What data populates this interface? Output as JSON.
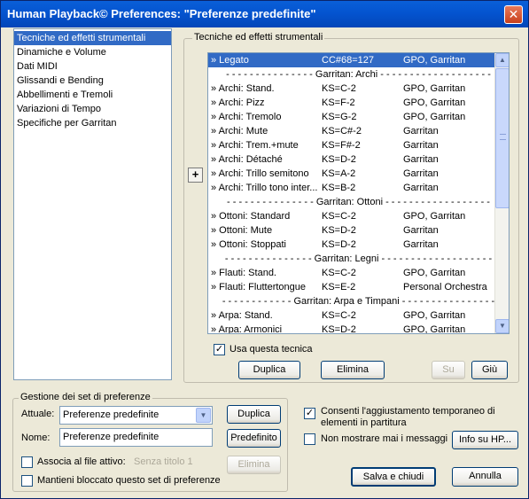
{
  "window": {
    "title": "Human Playback© Preferences: \"Preferenze predefinite\"",
    "close_label": "✕"
  },
  "categories": [
    "Tecniche ed effetti strumentali",
    "Dinamiche e Volume",
    "Dati MIDI",
    "Glissandi e Bending",
    "Abbellimenti e Tremoli",
    "Variazioni di Tempo",
    "Specifiche per Garritan"
  ],
  "techniques": {
    "group_title": "Tecniche ed effetti strumentali",
    "add_label": "+",
    "rows": [
      {
        "type": "row",
        "name": "» Legato",
        "ks": "CC#68=127",
        "lib": "GPO, Garritan",
        "selected": true
      },
      {
        "type": "sep",
        "label": "- - - - - - - - - - - - - - - Garritan: Archi - - - - - - - - - - - - - - - - - - -"
      },
      {
        "type": "row",
        "name": "» Archi: Stand.",
        "ks": "KS=C-2",
        "lib": "GPO, Garritan"
      },
      {
        "type": "row",
        "name": "» Archi: Pizz",
        "ks": "KS=F-2",
        "lib": "GPO, Garritan"
      },
      {
        "type": "row",
        "name": "» Archi: Tremolo",
        "ks": "KS=G-2",
        "lib": "GPO, Garritan"
      },
      {
        "type": "row",
        "name": "» Archi: Mute",
        "ks": "KS=C#-2",
        "lib": "Garritan"
      },
      {
        "type": "row",
        "name": "» Archi: Trem.+mute",
        "ks": "KS=F#-2",
        "lib": "Garritan"
      },
      {
        "type": "row",
        "name": "» Archi: Détaché",
        "ks": "KS=D-2",
        "lib": "Garritan"
      },
      {
        "type": "row",
        "name": "» Archi: Trillo semitono",
        "ks": "KS=A-2",
        "lib": "Garritan"
      },
      {
        "type": "row",
        "name": "» Archi: Trillo tono inter...",
        "ks": "KS=B-2",
        "lib": "Garritan"
      },
      {
        "type": "sep",
        "label": "- - - - - - - - - - - - - - - Garritan: Ottoni - - - - - - - - - - - - - - - - - -"
      },
      {
        "type": "row",
        "name": "» Ottoni: Standard",
        "ks": "KS=C-2",
        "lib": "GPO, Garritan"
      },
      {
        "type": "row",
        "name": "» Ottoni: Mute",
        "ks": "KS=D-2",
        "lib": "Garritan"
      },
      {
        "type": "row",
        "name": "» Ottoni: Stoppati",
        "ks": "KS=D-2",
        "lib": "Garritan"
      },
      {
        "type": "sep",
        "label": "- - - - - - - - - - - - - - - Garritan: Legni - - - - - - - - - - - - - - - - - - -"
      },
      {
        "type": "row",
        "name": "» Flauti: Stand.",
        "ks": "KS=C-2",
        "lib": "GPO, Garritan"
      },
      {
        "type": "row",
        "name": "» Flauti: Fluttertongue",
        "ks": "KS=E-2",
        "lib": "Personal Orchestra"
      },
      {
        "type": "sep",
        "label": "- - - - - - - - - - - - Garritan: Arpa e Timpani - - - - - - - - - - - - - - - -"
      },
      {
        "type": "row",
        "name": "» Arpa: Stand.",
        "ks": "KS=C-2",
        "lib": "GPO, Garritan"
      },
      {
        "type": "row",
        "name": "» Arpa: Armonici",
        "ks": "KS=D-2",
        "lib": "GPO, Garritan"
      }
    ],
    "use_technique_label": "Usa questa tecnica",
    "use_technique_checked": true,
    "duplicate_label": "Duplica",
    "delete_label": "Elimina",
    "up_label": "Su",
    "down_label": "Giù",
    "scroll_up": "▲",
    "scroll_down": "▼"
  },
  "preference_sets": {
    "group_title": "Gestione dei set di preferenze",
    "current_label": "Attuale:",
    "current_value": "Preferenze predefinite",
    "duplicate_label": "Duplica",
    "name_label": "Nome:",
    "name_value": "Preferenze predefinite",
    "default_label": "Predefinito",
    "associate_label": "Associa al file attivo:",
    "associate_file": "Senza titolo 1",
    "delete_label": "Elimina",
    "keep_locked_label": "Mantieni bloccato questo set di preferenze",
    "dropdown_glyph": "▼"
  },
  "options": {
    "allow_adjust_label": "Consenti l'aggiustamento temporaneo di elementi in partitura",
    "allow_adjust_checked": true,
    "never_show_label": "Non mostrare mai i messaggi",
    "never_show_checked": false,
    "info_label": "Info su HP...",
    "save_close_label": "Salva e chiudi",
    "cancel_label": "Annulla",
    "check_glyph": "✓"
  }
}
